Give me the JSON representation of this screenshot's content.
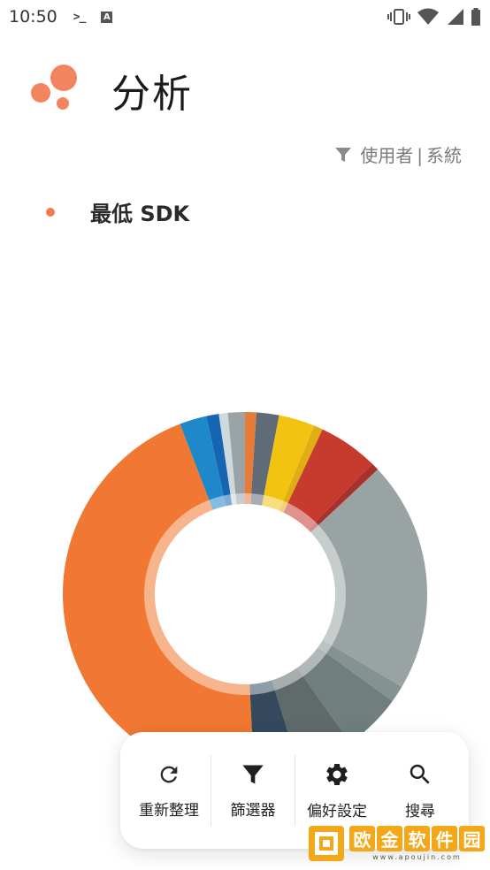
{
  "status_bar": {
    "time": "10:50",
    "icons": [
      "terminal-icon",
      "a-box-icon",
      "vibrate-icon",
      "wifi-icon",
      "signal-icon",
      "battery-icon"
    ]
  },
  "header": {
    "title": "分析",
    "logo_icon": "bubbles-logo-icon",
    "logo_color": "#f4845f"
  },
  "filter": {
    "icon": "filter-icon",
    "option_user": "使用者",
    "separator": "|",
    "option_system": "系統"
  },
  "legend": {
    "label": "最低 SDK",
    "color": "#f07c4f"
  },
  "chart_data": {
    "type": "pie",
    "title": "",
    "segments": [
      {
        "value": 1.0,
        "color": "#e87b38"
      },
      {
        "value": 2.0,
        "color": "#5f6b77"
      },
      {
        "value": 3.2,
        "color": "#f2c411"
      },
      {
        "value": 0.8,
        "color": "#e0ad12"
      },
      {
        "value": 5.3,
        "color": "#c73b2e"
      },
      {
        "value": 0.7,
        "color": "#a8322a"
      },
      {
        "value": 20.5,
        "color": "#99a3a3"
      },
      {
        "value": 1.5,
        "color": "#859292"
      },
      {
        "value": 5.2,
        "color": "#717e7e"
      },
      {
        "value": 5.0,
        "color": "#606a6a"
      },
      {
        "value": 4.0,
        "color": "#34495e"
      },
      {
        "value": 45.0,
        "color": "#f07832"
      },
      {
        "value": 2.4,
        "color": "#1e88c8"
      },
      {
        "value": 1.1,
        "color": "#1565b0"
      },
      {
        "value": 0.8,
        "color": "#cfd8dc"
      },
      {
        "value": 1.5,
        "color": "#9aa4a6"
      }
    ]
  },
  "toolbar": {
    "refresh_label": "重新整理",
    "filter_label": "篩選器",
    "settings_label": "偏好設定",
    "search_label": "搜尋"
  },
  "watermark": {
    "chars": [
      "欧",
      "金",
      "软",
      "件",
      "园"
    ],
    "url": "www.apoujin.com",
    "color": "#f3a818"
  }
}
